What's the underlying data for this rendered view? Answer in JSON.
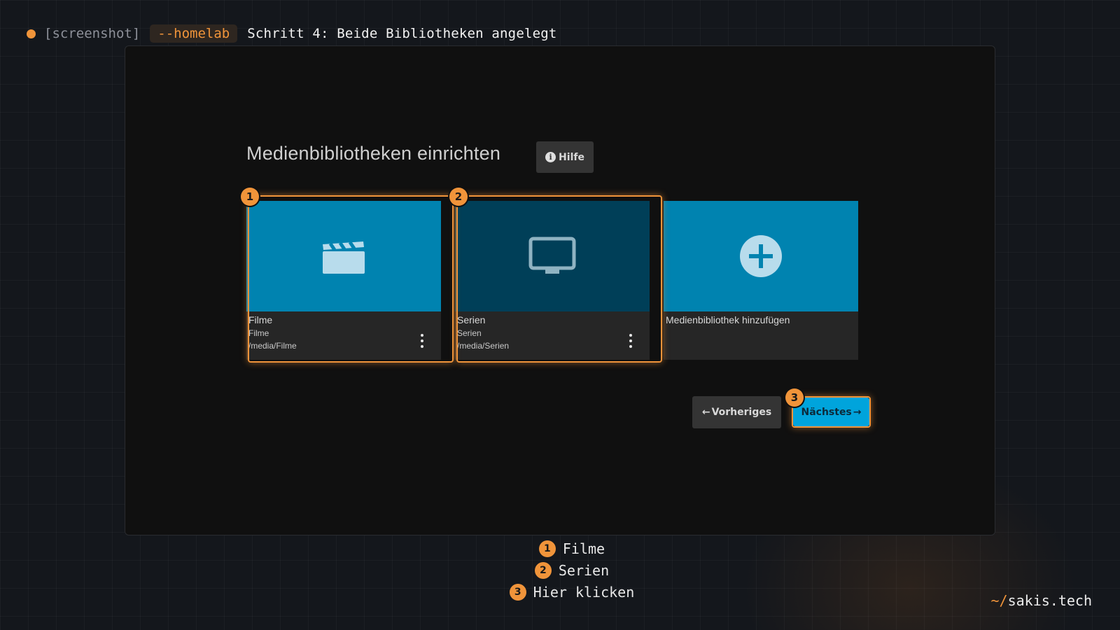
{
  "header": {
    "tag_screenshot": "[screenshot]",
    "tag_homelab": "--homelab",
    "title": "Schritt 4: Beide Bibliotheken angelegt"
  },
  "dialog": {
    "title": "Medienbibliotheken einrichten",
    "help_label": "Hilfe",
    "help_icon": "info-icon",
    "libraries": [
      {
        "name": "Filme",
        "type": "Filme",
        "path": "/media/Filme",
        "icon": "clapperboard-icon",
        "color": "#0083b0"
      },
      {
        "name": "Serien",
        "type": "Serien",
        "path": "/media/Serien",
        "icon": "tv-icon",
        "color": "#003f58"
      }
    ],
    "add_library": {
      "label": "Medienbibliothek hinzufügen",
      "icon": "plus-circle-icon",
      "color": "#0083b0"
    },
    "prev_label": "Vorheriges",
    "next_label": "Nächstes"
  },
  "badges": [
    "1",
    "2",
    "3"
  ],
  "legend": [
    {
      "num": "1",
      "text": "Filme"
    },
    {
      "num": "2",
      "text": "Serien"
    },
    {
      "num": "3",
      "text": "Hier klicken"
    }
  ],
  "brand": {
    "prefix": "~/",
    "name": "sakis.tech"
  },
  "colors": {
    "accent": "#f0943a",
    "primary_button": "#00a4dc"
  }
}
